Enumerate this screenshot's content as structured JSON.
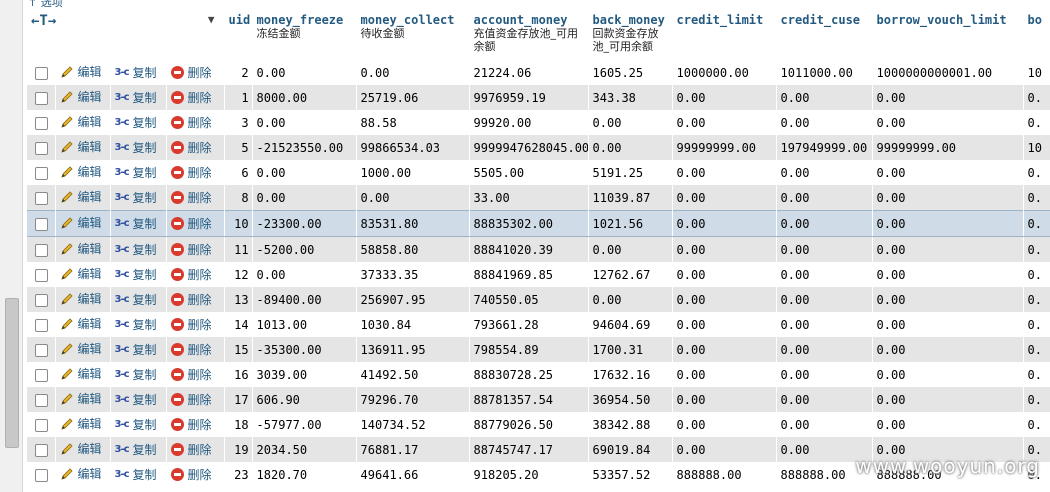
{
  "top_note": "↑ 选项",
  "nav_arrows": "←T→",
  "sort_indicator": "▼",
  "action_labels": {
    "edit": "编辑",
    "copy": "复制",
    "delete": "删除"
  },
  "columns": [
    {
      "name": "uid",
      "comment": ""
    },
    {
      "name": "money_freeze",
      "comment": "冻结金额"
    },
    {
      "name": "money_collect",
      "comment": "待收金额"
    },
    {
      "name": "account_money",
      "comment": "充值资金存放池_可用余额"
    },
    {
      "name": "back_money",
      "comment": "回款资金存放池_可用余额"
    },
    {
      "name": "credit_limit",
      "comment": ""
    },
    {
      "name": "credit_cuse",
      "comment": ""
    },
    {
      "name": "borrow_vouch_limit",
      "comment": ""
    },
    {
      "name": "bo",
      "comment": ""
    }
  ],
  "rows": [
    {
      "uid": "2",
      "money_freeze": "0.00",
      "money_collect": "0.00",
      "account_money": "21224.06",
      "back_money": "1605.25",
      "credit_limit": "1000000.00",
      "credit_cuse": "1011000.00",
      "borrow_vouch_limit": "1000000000001.00",
      "bo": "10"
    },
    {
      "uid": "1",
      "money_freeze": "8000.00",
      "money_collect": "25719.06",
      "account_money": "9976959.19",
      "back_money": "343.38",
      "credit_limit": "0.00",
      "credit_cuse": "0.00",
      "borrow_vouch_limit": "0.00",
      "bo": "0."
    },
    {
      "uid": "3",
      "money_freeze": "0.00",
      "money_collect": "88.58",
      "account_money": "99920.00",
      "back_money": "0.00",
      "credit_limit": "0.00",
      "credit_cuse": "0.00",
      "borrow_vouch_limit": "0.00",
      "bo": "0."
    },
    {
      "uid": "5",
      "money_freeze": "-21523550.00",
      "money_collect": "99866534.03",
      "account_money": "9999947628045.00",
      "back_money": "0.00",
      "credit_limit": "99999999.00",
      "credit_cuse": "197949999.00",
      "borrow_vouch_limit": "99999999.00",
      "bo": "10"
    },
    {
      "uid": "6",
      "money_freeze": "0.00",
      "money_collect": "1000.00",
      "account_money": "5505.00",
      "back_money": "5191.25",
      "credit_limit": "0.00",
      "credit_cuse": "0.00",
      "borrow_vouch_limit": "0.00",
      "bo": "0."
    },
    {
      "uid": "8",
      "money_freeze": "0.00",
      "money_collect": "0.00",
      "account_money": "33.00",
      "back_money": "11039.87",
      "credit_limit": "0.00",
      "credit_cuse": "0.00",
      "borrow_vouch_limit": "0.00",
      "bo": "0."
    },
    {
      "uid": "10",
      "money_freeze": "-23300.00",
      "money_collect": "83531.80",
      "account_money": "88835302.00",
      "back_money": "1021.56",
      "credit_limit": "0.00",
      "credit_cuse": "0.00",
      "borrow_vouch_limit": "0.00",
      "bo": "0."
    },
    {
      "uid": "11",
      "money_freeze": "-5200.00",
      "money_collect": "58858.80",
      "account_money": "88841020.39",
      "back_money": "0.00",
      "credit_limit": "0.00",
      "credit_cuse": "0.00",
      "borrow_vouch_limit": "0.00",
      "bo": "0."
    },
    {
      "uid": "12",
      "money_freeze": "0.00",
      "money_collect": "37333.35",
      "account_money": "88841969.85",
      "back_money": "12762.67",
      "credit_limit": "0.00",
      "credit_cuse": "0.00",
      "borrow_vouch_limit": "0.00",
      "bo": "0."
    },
    {
      "uid": "13",
      "money_freeze": "-89400.00",
      "money_collect": "256907.95",
      "account_money": "740550.05",
      "back_money": "0.00",
      "credit_limit": "0.00",
      "credit_cuse": "0.00",
      "borrow_vouch_limit": "0.00",
      "bo": "0."
    },
    {
      "uid": "14",
      "money_freeze": "1013.00",
      "money_collect": "1030.84",
      "account_money": "793661.28",
      "back_money": "94604.69",
      "credit_limit": "0.00",
      "credit_cuse": "0.00",
      "borrow_vouch_limit": "0.00",
      "bo": "0."
    },
    {
      "uid": "15",
      "money_freeze": "-35300.00",
      "money_collect": "136911.95",
      "account_money": "798554.89",
      "back_money": "1700.31",
      "credit_limit": "0.00",
      "credit_cuse": "0.00",
      "borrow_vouch_limit": "0.00",
      "bo": "0."
    },
    {
      "uid": "16",
      "money_freeze": "3039.00",
      "money_collect": "41492.50",
      "account_money": "88830728.25",
      "back_money": "17632.16",
      "credit_limit": "0.00",
      "credit_cuse": "0.00",
      "borrow_vouch_limit": "0.00",
      "bo": "0."
    },
    {
      "uid": "17",
      "money_freeze": "606.90",
      "money_collect": "79296.70",
      "account_money": "88781357.54",
      "back_money": "36954.50",
      "credit_limit": "0.00",
      "credit_cuse": "0.00",
      "borrow_vouch_limit": "0.00",
      "bo": "0."
    },
    {
      "uid": "18",
      "money_freeze": "-57977.00",
      "money_collect": "140734.52",
      "account_money": "88779026.50",
      "back_money": "38342.88",
      "credit_limit": "0.00",
      "credit_cuse": "0.00",
      "borrow_vouch_limit": "0.00",
      "bo": "0."
    },
    {
      "uid": "19",
      "money_freeze": "2034.50",
      "money_collect": "76881.17",
      "account_money": "88745747.17",
      "back_money": "69019.84",
      "credit_limit": "0.00",
      "credit_cuse": "0.00",
      "borrow_vouch_limit": "0.00",
      "bo": "0."
    },
    {
      "uid": "23",
      "money_freeze": "1820.70",
      "money_collect": "49641.66",
      "account_money": "918205.20",
      "back_money": "53357.52",
      "credit_limit": "888888.00",
      "credit_cuse": "888888.00",
      "borrow_vouch_limit": "888888.00",
      "bo": "0."
    }
  ],
  "highlighted_row_uid": "10",
  "watermark": "www.wooyun.org",
  "colors": {
    "link": "#235a81",
    "row_even": "#e5e5e5",
    "row_highlight": "#cfdbe6",
    "delete_icon": "#d83a2e"
  }
}
